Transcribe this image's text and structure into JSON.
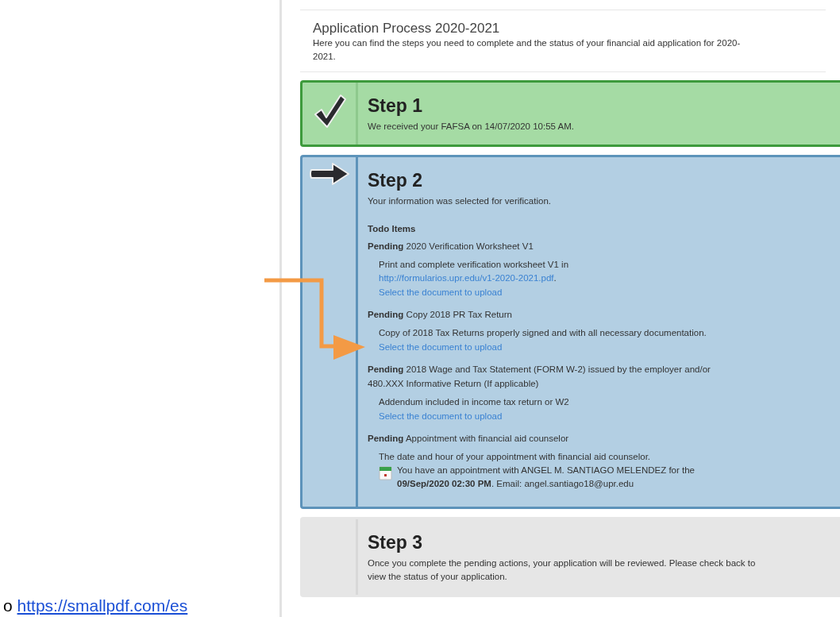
{
  "page": {
    "title": "Application Process 2020-2021",
    "subtitle": "Here you can find the steps you need to complete and the status of your financial aid application for 2020-2021."
  },
  "steps": [
    {
      "kind": "done",
      "title": "Step 1",
      "text": "We received your FAFSA on 14/07/2020 10:55 AM."
    },
    {
      "kind": "current",
      "title": "Step 2",
      "text": "Your information was selected for verification.",
      "todo_heading": "Todo Items",
      "todo_items": [
        {
          "status": "Pending",
          "title": "2020 Verification Worksheet V1",
          "description": "Print and complete verification worksheet V1 in ",
          "link": "http://formularios.upr.edu/v1-2020-2021.pdf",
          "description_end": ".",
          "upload": "Select the document to upload"
        },
        {
          "status": "Pending",
          "title": "Copy 2018 PR Tax Return",
          "description": "Copy of 2018 Tax Returns properly signed and with all necessary documentation.",
          "upload": "Select the document to upload"
        },
        {
          "status": "Pending",
          "title": "2018 Wage and Tax Statement (FORM W-2) issued by the employer and/or 480.XXX Informative Return (If applicable)",
          "description": "Addendum included in income tax return or W2",
          "upload": "Select the document to upload"
        },
        {
          "status": "Pending",
          "title": "Appointment with financial aid counselor",
          "description": "The date and hour of your appointment with financial aid counselor.",
          "appointment": "You have an appointment with ANGEL M. SANTIAGO MELENDEZ for the **09/Sep/2020 02:30 PM**. Email: angel.santiago18@upr.edu"
        }
      ]
    },
    {
      "kind": "pending",
      "title": "Step 3",
      "text": "Once you complete the pending actions, your application will be reviewed. Please check back to view the status of your application."
    }
  ],
  "side_link": {
    "prefix": "o",
    "url": "https://smallpdf.com/es"
  }
}
